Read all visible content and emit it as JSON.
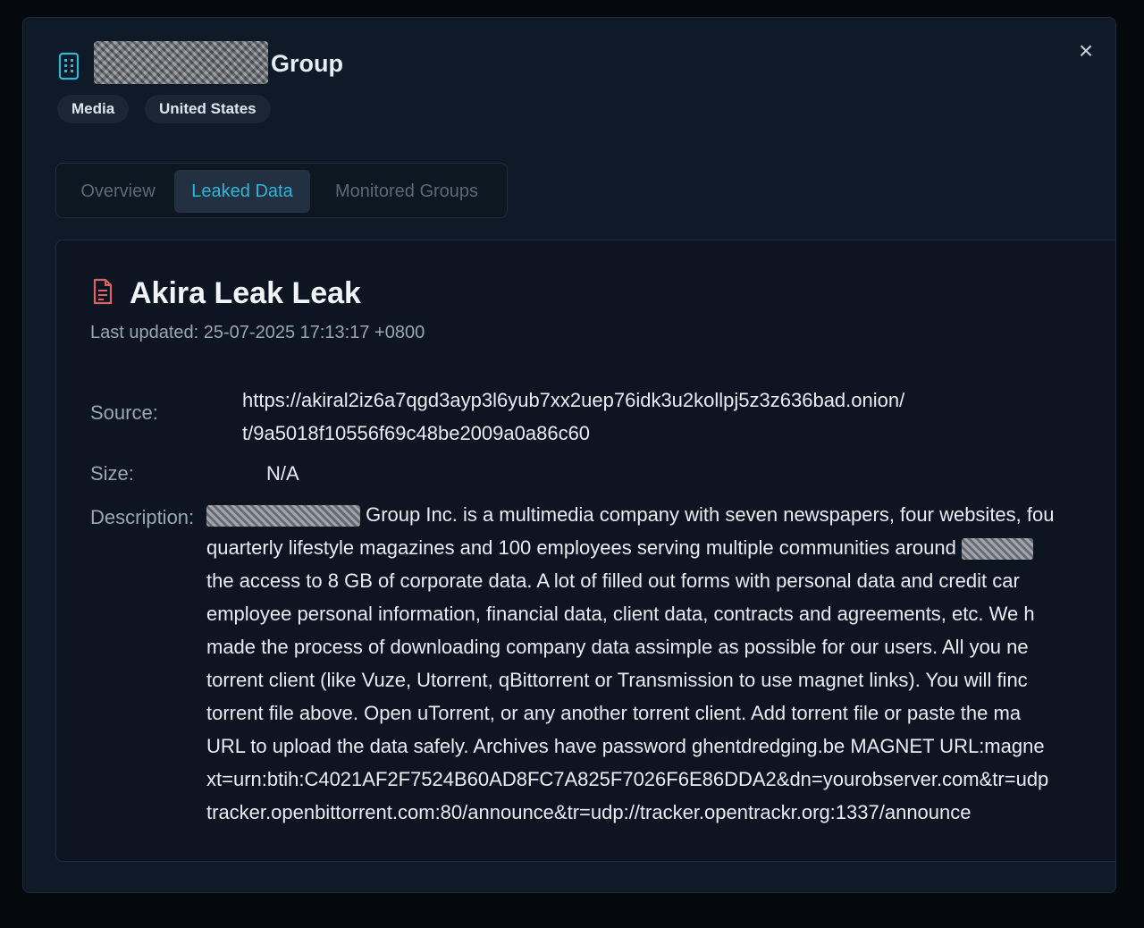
{
  "header": {
    "title_suffix": "Group",
    "tags": [
      "Media",
      "United States"
    ],
    "close_symbol": "×"
  },
  "tabs": [
    {
      "label": "Overview",
      "active": false
    },
    {
      "label": "Leaked Data",
      "active": true
    },
    {
      "label": "Monitored Groups",
      "active": false
    }
  ],
  "leak": {
    "title": "Akira Leak Leak",
    "last_updated": "Last updated: 25-07-2025 17:13:17 +0800",
    "source_label": "Source:",
    "source_lines": [
      "https://akiral2iz6a7qgd3ayp3l6yub7xx2uep76idk3u2kollpj5z3z636bad.onion/",
      "t/9a5018f10556f69c48be2009a0a86c60"
    ],
    "size_label": "Size:",
    "size_value": "N/A",
    "description_label": "Description:",
    "description_lines": [
      " Group Inc. is a multimedia company with seven newspapers, four websites, fou",
      "quarterly lifestyle magazines and 100 employees serving multiple communities around ",
      "the access to 8 GB of corporate data. A lot of filled out forms with personal data and credit car",
      "employee personal information, financial data, client data, contracts and agreements, etc. We h",
      "made the process of downloading company data assimple as possible for our users. All you ne",
      "torrent client (like Vuze, Utorrent, qBittorrent or Transmission to use magnet links). You will finc",
      "torrent file above. Open uTorrent, or any another torrent client. Add torrent file or paste the ma",
      "URL to upload the data safely. Archives have password ghentdredging.be MAGNET URL:magne",
      "xt=urn:btih:C4021AF2F7524B60AD8FC7A825F7026F6E86DDA2&dn=yourobserver.com&tr=udp",
      "tracker.openbittorrent.com:80/announce&tr=udp://tracker.opentrackr.org:1337/announce"
    ]
  },
  "colors": {
    "background": "#0f1a28",
    "accent": "#2fb6d6",
    "doc_icon": "#e06262"
  }
}
